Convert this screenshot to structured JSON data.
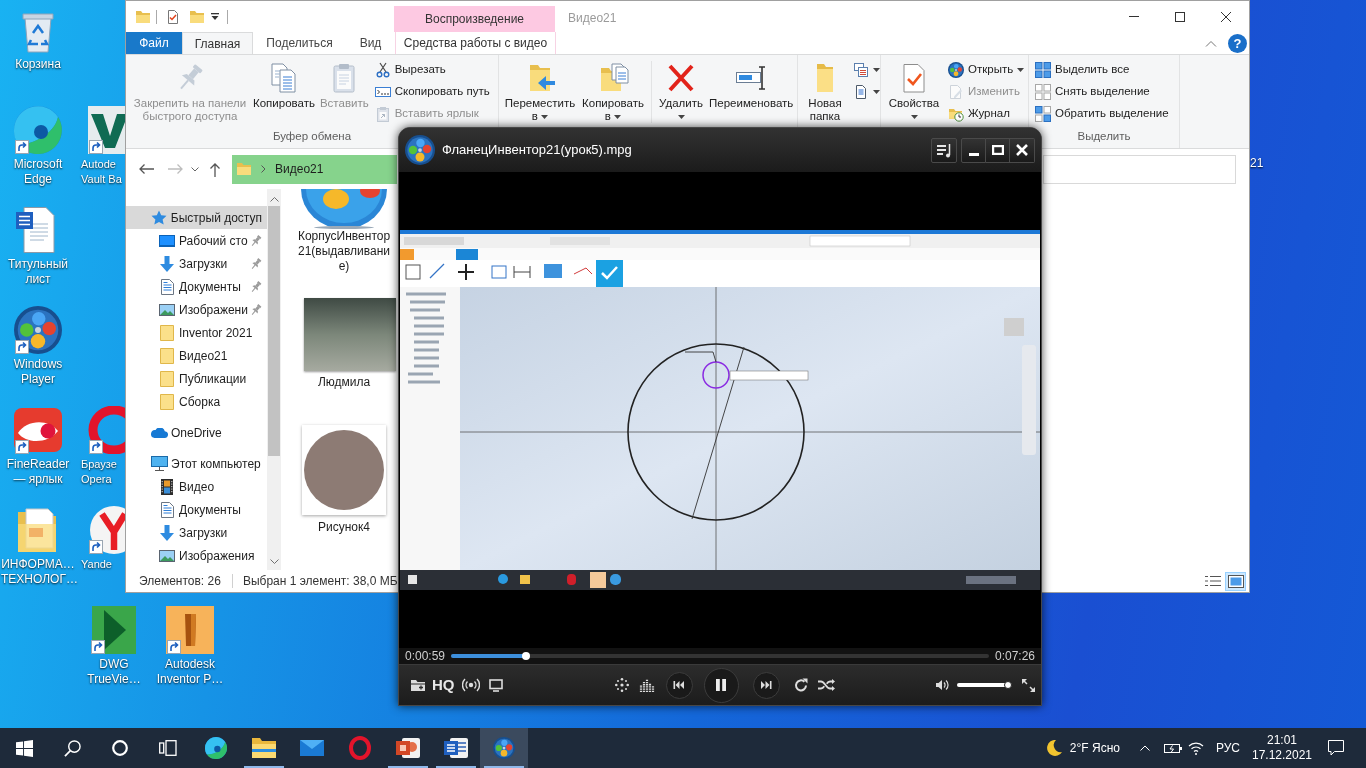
{
  "desktop": {
    "icons": [
      {
        "label": "Корзина",
        "shortcut": false
      },
      {
        "label": "Microsoft Edge",
        "shortcut": true
      },
      {
        "label": "Титульный лист",
        "shortcut": false
      },
      {
        "label": "Windows Player",
        "shortcut": true
      },
      {
        "label": "FineReader — ярлык",
        "shortcut": true
      },
      {
        "label": "ИНФОРМА… ТЕХНОЛОГ…",
        "shortcut": false
      },
      {
        "label": "Autode Vault Ba",
        "shortcut": true
      },
      {
        "label": "Браузе Opera",
        "shortcut": true
      },
      {
        "label": "Yande",
        "shortcut": true
      },
      {
        "label": "DWG TrueVie…",
        "shortcut": true
      },
      {
        "label": "Autodesk Inventor P…",
        "shortcut": true
      }
    ],
    "partial_label": "21"
  },
  "explorer": {
    "contextual_group": "Воспроизведение",
    "title": "Видео21",
    "tabs": [
      {
        "label": "Файл",
        "kind": "file",
        "selected": false
      },
      {
        "label": "Главная",
        "kind": "standard",
        "selected": true
      },
      {
        "label": "Поделиться",
        "kind": "standard",
        "selected": false
      },
      {
        "label": "Вид",
        "kind": "standard",
        "selected": false
      },
      {
        "label": "Средства работы с видео",
        "kind": "contextual",
        "selected": false
      }
    ],
    "help": "?",
    "ribbon": [
      {
        "label": "Буфер обмена",
        "buttons": [
          {
            "label": "Закрепить на панели быстрого доступа",
            "kind": "large",
            "disabled": true,
            "dropdown": false
          },
          {
            "label": "Копировать",
            "kind": "large",
            "disabled": false,
            "dropdown": false
          },
          {
            "label": "Вставить",
            "kind": "large",
            "disabled": true,
            "dropdown": false
          },
          {
            "label": "Вырезать",
            "kind": "small",
            "disabled": false,
            "dropdown": false
          },
          {
            "label": "Скопировать путь",
            "kind": "small",
            "disabled": false,
            "dropdown": false
          },
          {
            "label": "Вставить ярлык",
            "kind": "small",
            "disabled": true,
            "dropdown": false
          }
        ]
      },
      {
        "buttons": [
          {
            "label": "Переместить в",
            "kind": "large",
            "disabled": false,
            "dropdown": true
          },
          {
            "label": "Копировать в",
            "kind": "large",
            "disabled": false,
            "dropdown": true
          },
          {
            "label": "Удалить",
            "kind": "large",
            "disabled": false,
            "dropdown": true
          },
          {
            "label": "Переименовать",
            "kind": "large",
            "disabled": false,
            "dropdown": false
          }
        ]
      },
      {
        "buttons": [
          {
            "label": "Новая папка",
            "kind": "large",
            "disabled": false,
            "dropdown": false
          },
          {
            "kind": "icon",
            "disabled": false,
            "dropdown": true
          },
          {
            "kind": "icon",
            "disabled": false,
            "dropdown": true
          }
        ]
      },
      {
        "buttons": [
          {
            "label": "Свойства",
            "kind": "large",
            "disabled": false,
            "dropdown": true
          },
          {
            "label": "Открыть",
            "kind": "small",
            "disabled": false,
            "dropdown": true
          },
          {
            "label": "Изменить",
            "kind": "small",
            "disabled": true,
            "dropdown": false
          },
          {
            "label": "Журнал",
            "kind": "small",
            "disabled": false,
            "dropdown": false
          }
        ]
      },
      {
        "label": "Выделить",
        "buttons": [
          {
            "label": "Выделить все",
            "kind": "small",
            "disabled": false,
            "dropdown": false
          },
          {
            "label": "Снять выделение",
            "kind": "small",
            "disabled": false,
            "dropdown": false
          },
          {
            "label": "Обратить выделение",
            "kind": "small",
            "disabled": false,
            "dropdown": false
          }
        ]
      }
    ],
    "address": "Видео21",
    "navigation": [
      {
        "label": "Быстрый доступ",
        "selected": true,
        "children": [
          {
            "label": "Рабочий сто",
            "selected": false,
            "pinned": true
          },
          {
            "label": "Загрузки",
            "selected": false,
            "pinned": true
          },
          {
            "label": "Документы",
            "selected": false,
            "pinned": true
          },
          {
            "label": "Изображени",
            "selected": false,
            "pinned": true
          },
          {
            "label": "Inventor 2021",
            "selected": false,
            "pinned": false
          },
          {
            "label": "Видео21",
            "selected": false,
            "pinned": false
          },
          {
            "label": "Публикации",
            "selected": false,
            "pinned": false
          },
          {
            "label": "Сборка",
            "selected": false,
            "pinned": false
          }
        ]
      },
      {
        "label": "OneDrive",
        "selected": false
      },
      {
        "label": "Этот компьютер",
        "selected": false,
        "children": [
          {
            "label": "Видео",
            "selected": false,
            "pinned": false
          },
          {
            "label": "Документы",
            "selected": false,
            "pinned": false
          },
          {
            "label": "Загрузки",
            "selected": false,
            "pinned": false
          },
          {
            "label": "Изображения",
            "selected": false,
            "pinned": false
          }
        ]
      }
    ],
    "files": [
      {
        "name": "КорпусИнвентор21(выдавливание)",
        "kind": "video"
      },
      {
        "name": "Людмила",
        "kind": "photo"
      },
      {
        "name": "Рисунок4",
        "kind": "round_photo"
      }
    ],
    "status": {
      "count": "Элементов: 26",
      "selection": "Выбран 1 элемент: 38,0 МБ"
    },
    "views": [
      {
        "selected": false
      },
      {
        "selected": true
      }
    ]
  },
  "player": {
    "title": "ФланецИнвентор21(урок5).mpg",
    "elapsed": "0:00:59",
    "duration": "0:07:26",
    "progress": {
      "level": 0.14
    },
    "quality": "HQ",
    "playing": true,
    "volume": {
      "level": 0.92
    }
  },
  "taskbar": {
    "apps": [
      {
        "selected": false,
        "running": false
      },
      {
        "selected": false,
        "running": true
      },
      {
        "selected": false,
        "running": false
      },
      {
        "selected": false,
        "running": false
      },
      {
        "selected": false,
        "running": true
      },
      {
        "selected": false,
        "running": true
      },
      {
        "selected": true,
        "running": true
      }
    ],
    "weather": "2°F Ясно",
    "language": "РУС",
    "time": "21:01",
    "date": "17.12.2021"
  }
}
